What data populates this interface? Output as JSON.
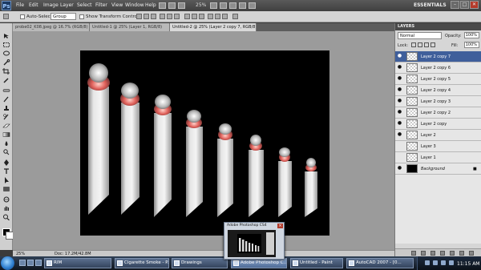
{
  "menubar": {
    "logo": "Ps",
    "items": [
      "File",
      "Edit",
      "Image",
      "Layer",
      "Select",
      "Filter",
      "View",
      "Window",
      "Help"
    ],
    "zoom": "25%",
    "workspace": "ESSENTIALS",
    "window_buttons": [
      "–",
      "□",
      "✕"
    ]
  },
  "options": {
    "auto_select_label": "Auto-Select:",
    "group_value": "Group",
    "transform_label": "Show Transform Controls"
  },
  "tabs": [
    "probe02_K08.jpeg @ 16.7% (RGB/8)",
    "Untitled-1 @ 25% (Layer 1, RGB/8)",
    "Untitled-2 @ 25% (Layer 2 copy 7, RGB/8)"
  ],
  "status": {
    "zoom": "25%",
    "doc": "Doc: 17.2M/42.8M"
  },
  "panel": {
    "title": "LAYERS",
    "blend_mode": "Normal",
    "opacity_label": "Opacity:",
    "opacity_value": "100%",
    "lock_label": "Lock:",
    "fill_label": "Fill:",
    "fill_value": "100%",
    "layers": [
      {
        "name": "Layer 2 copy 7",
        "selected": true,
        "visible": true
      },
      {
        "name": "Layer 2 copy 6",
        "selected": false,
        "visible": true
      },
      {
        "name": "Layer 2 copy 5",
        "selected": false,
        "visible": true
      },
      {
        "name": "Layer 2 copy 4",
        "selected": false,
        "visible": true
      },
      {
        "name": "Layer 2 copy 3",
        "selected": false,
        "visible": true
      },
      {
        "name": "Layer 2 copy 2",
        "selected": false,
        "visible": true
      },
      {
        "name": "Layer 2 copy",
        "selected": false,
        "visible": true
      },
      {
        "name": "Layer 2",
        "selected": false,
        "visible": true
      },
      {
        "name": "Layer 3",
        "selected": false,
        "visible": false
      },
      {
        "name": "Layer 1",
        "selected": false,
        "visible": false
      },
      {
        "name": "Background",
        "selected": false,
        "visible": true,
        "locked": true
      }
    ]
  },
  "popup": {
    "title": "Adobe Photoshop CS4"
  },
  "taskbar": {
    "tasks": [
      {
        "label": "RIM",
        "active": false
      },
      {
        "label": "Cigarette Smoke - P...",
        "active": false
      },
      {
        "label": "Drawings",
        "active": false
      },
      {
        "label": "Adobe Photoshop C...",
        "active": true
      },
      {
        "label": "Untitled - Paint",
        "active": false
      },
      {
        "label": "AutoCAD 2007 - [0...",
        "active": false
      }
    ],
    "clock": "11:15 AM"
  },
  "colors": {
    "accent_selected_layer": "#3f5f9b",
    "canvas_background": "#000000",
    "pasteboard": "#9b9b9b"
  }
}
